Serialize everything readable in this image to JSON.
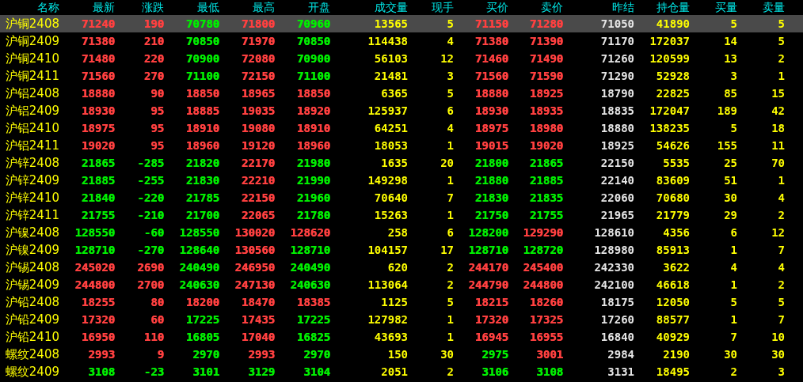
{
  "table": {
    "columns": [
      "名称",
      "最新",
      "涨跌",
      "最低",
      "最高",
      "开盘",
      "成交量",
      "现手",
      "买价",
      "卖价",
      "昨结",
      "持仓量",
      "买量",
      "卖量"
    ],
    "rows": [
      {
        "selected": true,
        "cells": [
          {
            "text": "沪铜2408"
          },
          {
            "text": "71240",
            "color": "#ff4040"
          },
          {
            "text": "190",
            "color": "#ff4040"
          },
          {
            "text": "70780",
            "color": "#00ee00"
          },
          {
            "text": "71800",
            "color": "#ff4040"
          },
          {
            "text": "70960",
            "color": "#00ee00"
          },
          {
            "text": "13565"
          },
          {
            "text": "5"
          },
          {
            "text": "71150",
            "color": "#ff4040"
          },
          {
            "text": "71280",
            "color": "#ff4040"
          },
          {
            "text": "71050"
          },
          {
            "text": "41890"
          },
          {
            "text": "5"
          },
          {
            "text": "5"
          }
        ]
      },
      {
        "selected": false,
        "cells": [
          {
            "text": "沪铜2409"
          },
          {
            "text": "71380",
            "color": "#ff4040"
          },
          {
            "text": "210",
            "color": "#ff4040"
          },
          {
            "text": "70850",
            "color": "#00ee00"
          },
          {
            "text": "71970",
            "color": "#ff4040"
          },
          {
            "text": "70850",
            "color": "#00ee00"
          },
          {
            "text": "114438"
          },
          {
            "text": "4"
          },
          {
            "text": "71380",
            "color": "#ff4040"
          },
          {
            "text": "71390",
            "color": "#ff4040"
          },
          {
            "text": "71170"
          },
          {
            "text": "172037"
          },
          {
            "text": "14"
          },
          {
            "text": "5"
          }
        ]
      },
      {
        "selected": false,
        "cells": [
          {
            "text": "沪铜2410"
          },
          {
            "text": "71480",
            "color": "#ff4040"
          },
          {
            "text": "220",
            "color": "#ff4040"
          },
          {
            "text": "70900",
            "color": "#00ee00"
          },
          {
            "text": "72080",
            "color": "#ff4040"
          },
          {
            "text": "70900",
            "color": "#00ee00"
          },
          {
            "text": "56103"
          },
          {
            "text": "12"
          },
          {
            "text": "71460",
            "color": "#ff4040"
          },
          {
            "text": "71490",
            "color": "#ff4040"
          },
          {
            "text": "71260"
          },
          {
            "text": "120599"
          },
          {
            "text": "13"
          },
          {
            "text": "2"
          }
        ]
      },
      {
        "selected": false,
        "cells": [
          {
            "text": "沪铜2411"
          },
          {
            "text": "71560",
            "color": "#ff4040"
          },
          {
            "text": "270",
            "color": "#ff4040"
          },
          {
            "text": "71100",
            "color": "#00ee00"
          },
          {
            "text": "72150",
            "color": "#ff4040"
          },
          {
            "text": "71100",
            "color": "#00ee00"
          },
          {
            "text": "21481"
          },
          {
            "text": "3"
          },
          {
            "text": "71560",
            "color": "#ff4040"
          },
          {
            "text": "71590",
            "color": "#ff4040"
          },
          {
            "text": "71290"
          },
          {
            "text": "52928"
          },
          {
            "text": "3"
          },
          {
            "text": "1"
          }
        ]
      },
      {
        "selected": false,
        "cells": [
          {
            "text": "沪铝2408"
          },
          {
            "text": "18880",
            "color": "#ff4040"
          },
          {
            "text": "90",
            "color": "#ff4040"
          },
          {
            "text": "18850",
            "color": "#ff4040"
          },
          {
            "text": "18965",
            "color": "#ff4040"
          },
          {
            "text": "18850",
            "color": "#ff4040"
          },
          {
            "text": "6365"
          },
          {
            "text": "5"
          },
          {
            "text": "18880",
            "color": "#ff4040"
          },
          {
            "text": "18925",
            "color": "#ff4040"
          },
          {
            "text": "18790"
          },
          {
            "text": "22825"
          },
          {
            "text": "85"
          },
          {
            "text": "15"
          }
        ]
      },
      {
        "selected": false,
        "cells": [
          {
            "text": "沪铝2409"
          },
          {
            "text": "18930",
            "color": "#ff4040"
          },
          {
            "text": "95",
            "color": "#ff4040"
          },
          {
            "text": "18885",
            "color": "#ff4040"
          },
          {
            "text": "19035",
            "color": "#ff4040"
          },
          {
            "text": "18920",
            "color": "#ff4040"
          },
          {
            "text": "125937"
          },
          {
            "text": "6"
          },
          {
            "text": "18930",
            "color": "#ff4040"
          },
          {
            "text": "18935",
            "color": "#ff4040"
          },
          {
            "text": "18835"
          },
          {
            "text": "172047"
          },
          {
            "text": "189"
          },
          {
            "text": "42"
          }
        ]
      },
      {
        "selected": false,
        "cells": [
          {
            "text": "沪铝2410"
          },
          {
            "text": "18975",
            "color": "#ff4040"
          },
          {
            "text": "95",
            "color": "#ff4040"
          },
          {
            "text": "18910",
            "color": "#ff4040"
          },
          {
            "text": "19080",
            "color": "#ff4040"
          },
          {
            "text": "18910",
            "color": "#ff4040"
          },
          {
            "text": "64251"
          },
          {
            "text": "4"
          },
          {
            "text": "18975",
            "color": "#ff4040"
          },
          {
            "text": "18980",
            "color": "#ff4040"
          },
          {
            "text": "18880"
          },
          {
            "text": "138235"
          },
          {
            "text": "5"
          },
          {
            "text": "18"
          }
        ]
      },
      {
        "selected": false,
        "cells": [
          {
            "text": "沪铝2411"
          },
          {
            "text": "19020",
            "color": "#ff4040"
          },
          {
            "text": "95",
            "color": "#ff4040"
          },
          {
            "text": "18960",
            "color": "#ff4040"
          },
          {
            "text": "19120",
            "color": "#ff4040"
          },
          {
            "text": "18960",
            "color": "#ff4040"
          },
          {
            "text": "18053"
          },
          {
            "text": "1"
          },
          {
            "text": "19015",
            "color": "#ff4040"
          },
          {
            "text": "19020",
            "color": "#ff4040"
          },
          {
            "text": "18925"
          },
          {
            "text": "54626"
          },
          {
            "text": "155"
          },
          {
            "text": "11"
          }
        ]
      },
      {
        "selected": false,
        "cells": [
          {
            "text": "沪锌2408"
          },
          {
            "text": "21865",
            "color": "#00ee00"
          },
          {
            "text": "-285",
            "color": "#00ee00"
          },
          {
            "text": "21820",
            "color": "#00ee00"
          },
          {
            "text": "22170",
            "color": "#ff4040"
          },
          {
            "text": "21980",
            "color": "#00ee00"
          },
          {
            "text": "1635"
          },
          {
            "text": "20"
          },
          {
            "text": "21800",
            "color": "#00ee00"
          },
          {
            "text": "21865",
            "color": "#00ee00"
          },
          {
            "text": "22150"
          },
          {
            "text": "5535"
          },
          {
            "text": "25"
          },
          {
            "text": "70"
          }
        ]
      },
      {
        "selected": false,
        "cells": [
          {
            "text": "沪锌2409"
          },
          {
            "text": "21885",
            "color": "#00ee00"
          },
          {
            "text": "-255",
            "color": "#00ee00"
          },
          {
            "text": "21830",
            "color": "#00ee00"
          },
          {
            "text": "22210",
            "color": "#ff4040"
          },
          {
            "text": "21990",
            "color": "#00ee00"
          },
          {
            "text": "149298"
          },
          {
            "text": "1"
          },
          {
            "text": "21880",
            "color": "#00ee00"
          },
          {
            "text": "21885",
            "color": "#00ee00"
          },
          {
            "text": "22140"
          },
          {
            "text": "83609"
          },
          {
            "text": "51"
          },
          {
            "text": "1"
          }
        ]
      },
      {
        "selected": false,
        "cells": [
          {
            "text": "沪锌2410"
          },
          {
            "text": "21840",
            "color": "#00ee00"
          },
          {
            "text": "-220",
            "color": "#00ee00"
          },
          {
            "text": "21785",
            "color": "#00ee00"
          },
          {
            "text": "22150",
            "color": "#ff4040"
          },
          {
            "text": "21960",
            "color": "#00ee00"
          },
          {
            "text": "70640"
          },
          {
            "text": "7"
          },
          {
            "text": "21830",
            "color": "#00ee00"
          },
          {
            "text": "21835",
            "color": "#00ee00"
          },
          {
            "text": "22060"
          },
          {
            "text": "70680"
          },
          {
            "text": "30"
          },
          {
            "text": "4"
          }
        ]
      },
      {
        "selected": false,
        "cells": [
          {
            "text": "沪锌2411"
          },
          {
            "text": "21755",
            "color": "#00ee00"
          },
          {
            "text": "-210",
            "color": "#00ee00"
          },
          {
            "text": "21700",
            "color": "#00ee00"
          },
          {
            "text": "22065",
            "color": "#ff4040"
          },
          {
            "text": "21780",
            "color": "#00ee00"
          },
          {
            "text": "15263"
          },
          {
            "text": "1"
          },
          {
            "text": "21750",
            "color": "#00ee00"
          },
          {
            "text": "21755",
            "color": "#00ee00"
          },
          {
            "text": "21965"
          },
          {
            "text": "21779"
          },
          {
            "text": "29"
          },
          {
            "text": "2"
          }
        ]
      },
      {
        "selected": false,
        "cells": [
          {
            "text": "沪镍2408"
          },
          {
            "text": "128550",
            "color": "#00ee00"
          },
          {
            "text": "-60",
            "color": "#00ee00"
          },
          {
            "text": "128550",
            "color": "#00ee00"
          },
          {
            "text": "130020",
            "color": "#ff4040"
          },
          {
            "text": "128620",
            "color": "#ff4040"
          },
          {
            "text": "258"
          },
          {
            "text": "6"
          },
          {
            "text": "128200",
            "color": "#00ee00"
          },
          {
            "text": "129290",
            "color": "#ff4040"
          },
          {
            "text": "128610"
          },
          {
            "text": "4356"
          },
          {
            "text": "6"
          },
          {
            "text": "12"
          }
        ]
      },
      {
        "selected": false,
        "cells": [
          {
            "text": "沪镍2409"
          },
          {
            "text": "128710",
            "color": "#00ee00"
          },
          {
            "text": "-270",
            "color": "#00ee00"
          },
          {
            "text": "128640",
            "color": "#00ee00"
          },
          {
            "text": "130560",
            "color": "#ff4040"
          },
          {
            "text": "128710",
            "color": "#00ee00"
          },
          {
            "text": "104157"
          },
          {
            "text": "17"
          },
          {
            "text": "128710",
            "color": "#00ee00"
          },
          {
            "text": "128720",
            "color": "#00ee00"
          },
          {
            "text": "128980"
          },
          {
            "text": "85913"
          },
          {
            "text": "1"
          },
          {
            "text": "7"
          }
        ]
      },
      {
        "selected": false,
        "cells": [
          {
            "text": "沪锡2408"
          },
          {
            "text": "245020",
            "color": "#ff4040"
          },
          {
            "text": "2690",
            "color": "#ff4040"
          },
          {
            "text": "240490",
            "color": "#00ee00"
          },
          {
            "text": "246950",
            "color": "#ff4040"
          },
          {
            "text": "240490",
            "color": "#00ee00"
          },
          {
            "text": "620"
          },
          {
            "text": "2"
          },
          {
            "text": "244170",
            "color": "#ff4040"
          },
          {
            "text": "245400",
            "color": "#ff4040"
          },
          {
            "text": "242330"
          },
          {
            "text": "3622"
          },
          {
            "text": "4"
          },
          {
            "text": "4"
          }
        ]
      },
      {
        "selected": false,
        "cells": [
          {
            "text": "沪锡2409"
          },
          {
            "text": "244800",
            "color": "#ff4040"
          },
          {
            "text": "2700",
            "color": "#ff4040"
          },
          {
            "text": "240630",
            "color": "#00ee00"
          },
          {
            "text": "247130",
            "color": "#ff4040"
          },
          {
            "text": "240630",
            "color": "#00ee00"
          },
          {
            "text": "113064"
          },
          {
            "text": "2"
          },
          {
            "text": "244790",
            "color": "#ff4040"
          },
          {
            "text": "244800",
            "color": "#ff4040"
          },
          {
            "text": "242100"
          },
          {
            "text": "46618"
          },
          {
            "text": "1"
          },
          {
            "text": "2"
          }
        ]
      },
      {
        "selected": false,
        "cells": [
          {
            "text": "沪铅2408"
          },
          {
            "text": "18255",
            "color": "#ff4040"
          },
          {
            "text": "80",
            "color": "#ff4040"
          },
          {
            "text": "18200",
            "color": "#ff4040"
          },
          {
            "text": "18470",
            "color": "#ff4040"
          },
          {
            "text": "18385",
            "color": "#ff4040"
          },
          {
            "text": "1125"
          },
          {
            "text": "5"
          },
          {
            "text": "18215",
            "color": "#ff4040"
          },
          {
            "text": "18260",
            "color": "#ff4040"
          },
          {
            "text": "18175"
          },
          {
            "text": "12050"
          },
          {
            "text": "5"
          },
          {
            "text": "5"
          }
        ]
      },
      {
        "selected": false,
        "cells": [
          {
            "text": "沪铅2409"
          },
          {
            "text": "17320",
            "color": "#ff4040"
          },
          {
            "text": "60",
            "color": "#ff4040"
          },
          {
            "text": "17225",
            "color": "#00ee00"
          },
          {
            "text": "17435",
            "color": "#ff4040"
          },
          {
            "text": "17225",
            "color": "#00ee00"
          },
          {
            "text": "127982"
          },
          {
            "text": "1"
          },
          {
            "text": "17320",
            "color": "#ff4040"
          },
          {
            "text": "17325",
            "color": "#ff4040"
          },
          {
            "text": "17260"
          },
          {
            "text": "88577"
          },
          {
            "text": "1"
          },
          {
            "text": "7"
          }
        ]
      },
      {
        "selected": false,
        "cells": [
          {
            "text": "沪铅2410"
          },
          {
            "text": "16950",
            "color": "#ff4040"
          },
          {
            "text": "110",
            "color": "#ff4040"
          },
          {
            "text": "16805",
            "color": "#00ee00"
          },
          {
            "text": "17040",
            "color": "#ff4040"
          },
          {
            "text": "16825",
            "color": "#00ee00"
          },
          {
            "text": "43693"
          },
          {
            "text": "1"
          },
          {
            "text": "16945",
            "color": "#ff4040"
          },
          {
            "text": "16955",
            "color": "#ff4040"
          },
          {
            "text": "16840"
          },
          {
            "text": "40929"
          },
          {
            "text": "7"
          },
          {
            "text": "10"
          }
        ]
      },
      {
        "selected": false,
        "cells": [
          {
            "text": "螺纹2408"
          },
          {
            "text": "2993",
            "color": "#ff4040"
          },
          {
            "text": "9",
            "color": "#ff4040"
          },
          {
            "text": "2970",
            "color": "#00ee00"
          },
          {
            "text": "2993",
            "color": "#ff4040"
          },
          {
            "text": "2970",
            "color": "#00ee00"
          },
          {
            "text": "150"
          },
          {
            "text": "30"
          },
          {
            "text": "2975",
            "color": "#00ee00"
          },
          {
            "text": "3001",
            "color": "#ff4040"
          },
          {
            "text": "2984"
          },
          {
            "text": "2190"
          },
          {
            "text": "30"
          },
          {
            "text": "30"
          }
        ]
      },
      {
        "selected": false,
        "cells": [
          {
            "text": "螺纹2409"
          },
          {
            "text": "3108",
            "color": "#00ee00"
          },
          {
            "text": "-23",
            "color": "#00ee00"
          },
          {
            "text": "3101",
            "color": "#00ee00"
          },
          {
            "text": "3129",
            "color": "#00ee00"
          },
          {
            "text": "3104",
            "color": "#00ee00"
          },
          {
            "text": "2051"
          },
          {
            "text": "2"
          },
          {
            "text": "3106",
            "color": "#00ee00"
          },
          {
            "text": "3108",
            "color": "#00ee00"
          },
          {
            "text": "3131"
          },
          {
            "text": "18495"
          },
          {
            "text": "2"
          },
          {
            "text": "3"
          }
        ]
      }
    ]
  }
}
